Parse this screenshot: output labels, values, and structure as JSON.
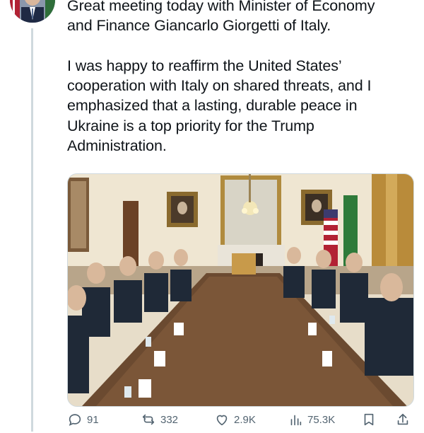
{
  "tweet": {
    "text": "Great meeting today with Minister of Economy\nand Finance Giancarlo Giorgetti of Italy.\n\nI was happy to reaffirm the United States’\ncooperation with Italy on shared threats, and I\nemphasized that a lasting, durable peace in\nUkraine is a top priority for the Trump\nAdministration."
  },
  "actions": {
    "reply_icon": "comment-icon",
    "reply_count": "91",
    "repost_icon": "repost-icon",
    "repost_count": "332",
    "like_icon": "heart-icon",
    "like_count": "2.9K",
    "views_icon": "views-chart-icon",
    "views_count": "75.3K",
    "bookmark_icon": "bookmark-icon",
    "share_icon": "share-icon"
  },
  "colors": {
    "text": "#0f1419",
    "muted": "#536471",
    "thread_line": "#cfd9de"
  }
}
